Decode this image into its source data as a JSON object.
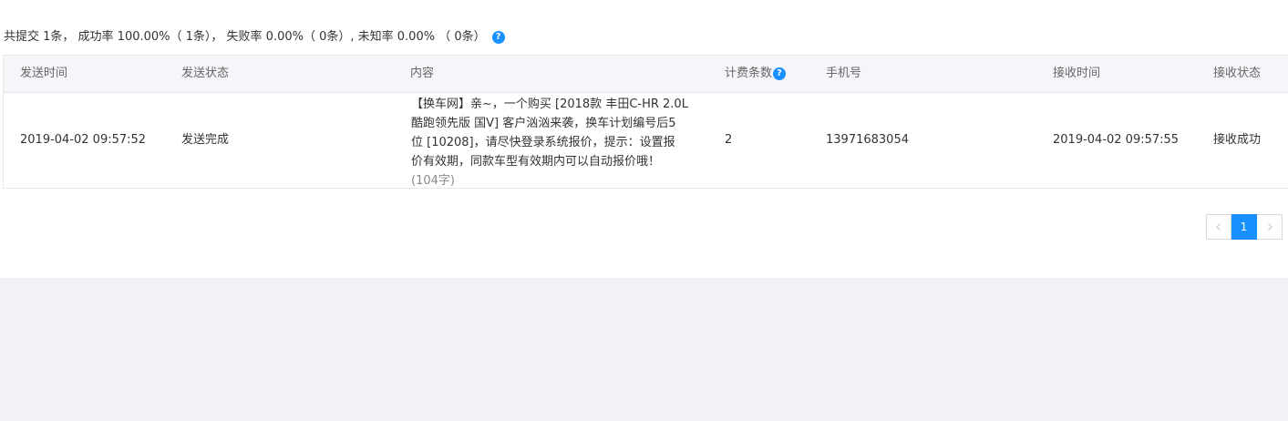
{
  "summary": {
    "text": "共提交 1条， 成功率 100.00%（ 1条）， 失败率 0.00%（ 0条）, 未知率 0.00% （ 0条）",
    "help_glyph": "?"
  },
  "table": {
    "headers": {
      "send_time": "发送时间",
      "send_status": "发送状态",
      "content": "内容",
      "billing_count": "计费条数",
      "phone": "手机号",
      "receive_time": "接收时间",
      "receive_status": "接收状态"
    },
    "help_glyph": "?",
    "rows": [
      {
        "send_time": "2019-04-02 09:57:52",
        "send_status": "发送完成",
        "content_lines": [
          "【换车网】亲~，一个购买 [2018款 丰田C-HR 2.0L",
          "酷跑领先版 国V] 客户汹汹来袭，换车计划编号后5",
          "位 [10208]，请尽快登录系统报价，提示：设置报",
          "价有效期，同款车型有效期内可以自动报价哦！"
        ],
        "char_count": "(104字)",
        "billing_count": "2",
        "phone": "13971683054",
        "receive_time": "2019-04-02 09:57:55",
        "receive_status": "接收成功"
      }
    ]
  },
  "pagination": {
    "current_page": "1",
    "prev_icon": "chevron-left-icon",
    "next_icon": "chevron-right-icon"
  },
  "colors": {
    "accent": "#1890ff",
    "header_bg": "#f5f6f9",
    "page_bg": "#f0f2f5"
  }
}
